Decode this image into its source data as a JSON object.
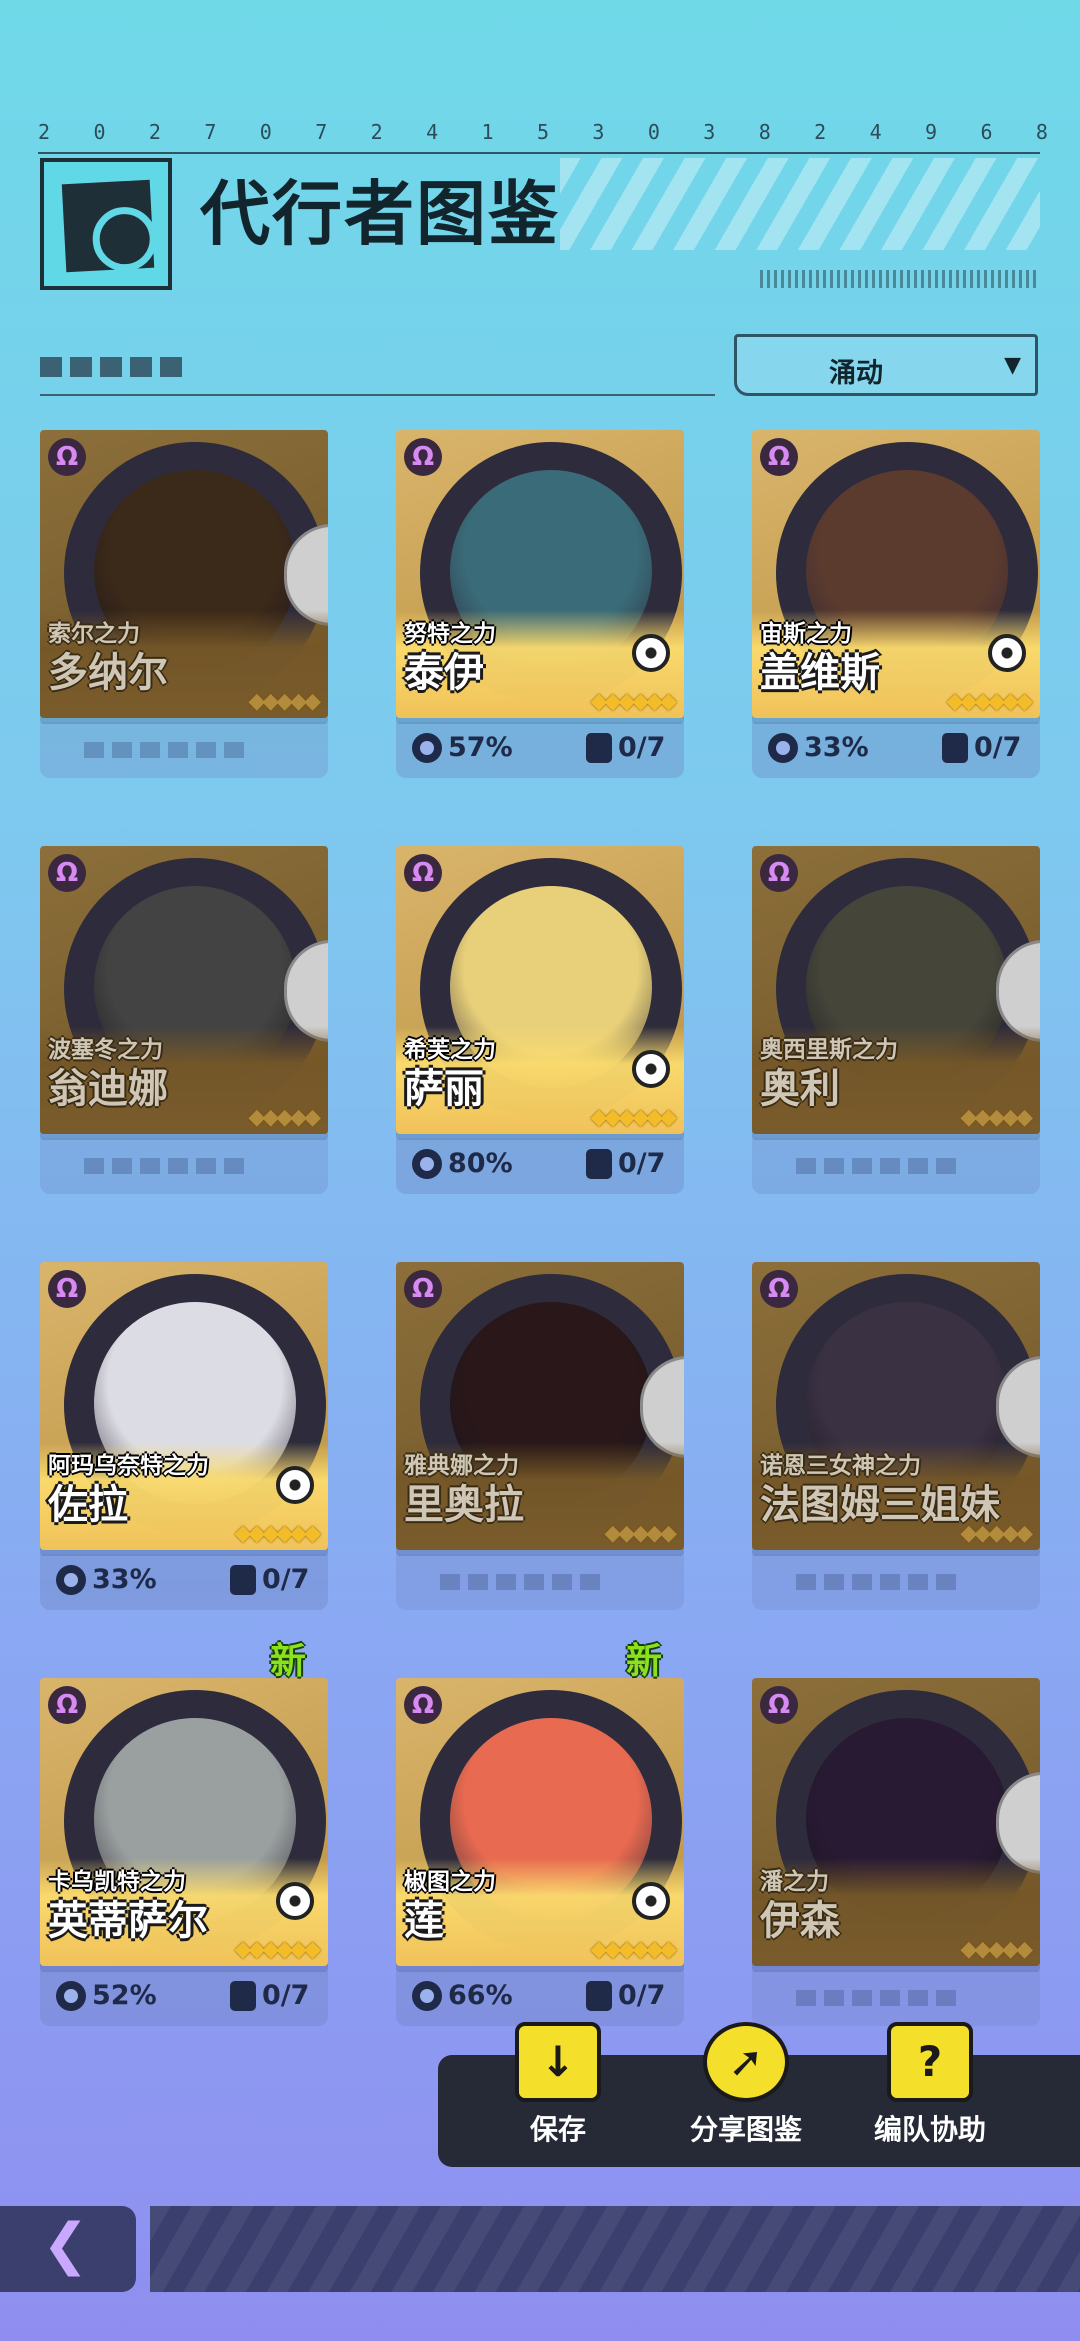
{
  "header": {
    "digits": [
      "2",
      "0",
      "2",
      "7",
      "0",
      "7",
      "2",
      "4",
      "1",
      "5",
      "3",
      "0",
      "3",
      "8",
      "2",
      "4",
      "9",
      "6",
      "8"
    ],
    "title": "代行者图鉴"
  },
  "filter": {
    "label": "涌动",
    "arrow": "▼"
  },
  "characters": [
    {
      "power": "索尔之力",
      "name": "多纳尔",
      "locked": true,
      "stars": "◆◆◆◆◆",
      "portrait": "#6b4a2e"
    },
    {
      "power": "努特之力",
      "name": "泰伊",
      "locked": false,
      "stars": "◆◆◆◆◆◆",
      "portrait": "#3a6b78",
      "progress": "57%",
      "relics": "0/7"
    },
    {
      "power": "宙斯之力",
      "name": "盖维斯",
      "locked": false,
      "stars": "◆◆◆◆◆◆",
      "portrait": "#5c3b2f",
      "progress": "33%",
      "relics": "0/7"
    },
    {
      "power": "波塞冬之力",
      "name": "翁迪娜",
      "locked": true,
      "stars": "◆◆◆◆◆",
      "portrait": "#7a7a7a"
    },
    {
      "power": "希芙之力",
      "name": "萨丽",
      "locked": false,
      "stars": "◆◆◆◆◆◆",
      "portrait": "#e8d07a",
      "progress": "80%",
      "relics": "0/7"
    },
    {
      "power": "奥西里斯之力",
      "name": "奥利",
      "locked": true,
      "stars": "◆◆◆◆◆",
      "portrait": "#7d7d6a"
    },
    {
      "power": "阿玛乌奈特之力",
      "name": "佐拉",
      "locked": false,
      "stars": "◆◆◆◆◆◆",
      "portrait": "#dcdce4",
      "progress": "33%",
      "relics": "0/7"
    },
    {
      "power": "雅典娜之力",
      "name": "里奥拉",
      "locked": true,
      "stars": "◆◆◆◆◆",
      "portrait": "#4a2a2e"
    },
    {
      "power": "诺恩三女神之力",
      "name": "法图姆三姐妹",
      "locked": true,
      "stars": "◆◆◆◆◆",
      "portrait": "#6a5a7a"
    },
    {
      "power": "卡乌凯特之力",
      "name": "英蒂萨尔",
      "locked": false,
      "stars": "◆◆◆◆◆◆",
      "portrait": "#9aa0a0",
      "progress": "52%",
      "relics": "0/7",
      "new": "新"
    },
    {
      "power": "椒图之力",
      "name": "莲",
      "locked": false,
      "stars": "◆◆◆◆◆◆",
      "portrait": "#e86a50",
      "progress": "66%",
      "relics": "0/7",
      "new": "新"
    },
    {
      "power": "潘之力",
      "name": "伊森",
      "locked": true,
      "stars": "◆◆◆◆◆",
      "portrait": "#4a2f5e"
    }
  ],
  "actions": [
    {
      "label": "保存",
      "icon": "↓"
    },
    {
      "label": "分享图鉴",
      "icon": "➚"
    },
    {
      "label": "编队协助",
      "icon": "?"
    }
  ],
  "nav": {
    "back": "❮"
  },
  "colors": {
    "accent": "#f4e02a",
    "new_tag": "#8be21b",
    "card_gold": "#d9b56c"
  }
}
